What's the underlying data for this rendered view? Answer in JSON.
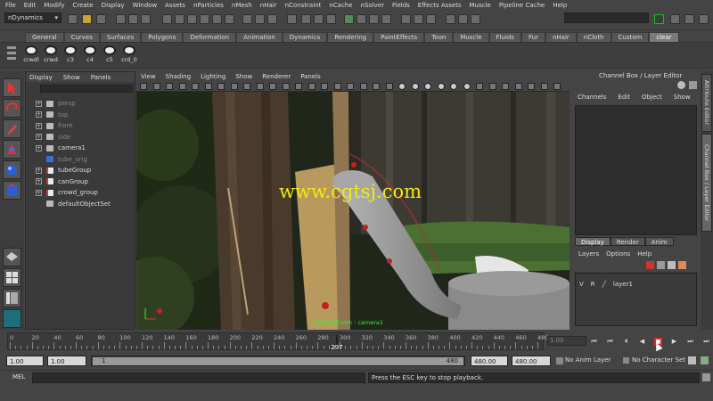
{
  "menubar": [
    "File",
    "Edit",
    "Modify",
    "Create",
    "Display",
    "Window",
    "Assets",
    "nParticles",
    "nMesh",
    "nHair",
    "nConstraint",
    "nCache",
    "nSolver",
    "Fields",
    "Effects Assets",
    "Muscle",
    "Pipeline Cache",
    "Help"
  ],
  "statusline": {
    "mode": "nDynamics"
  },
  "shelf_tabs": [
    "General",
    "Curves",
    "Surfaces",
    "Polygons",
    "Deformation",
    "Animation",
    "Dynamics",
    "Rendering",
    "PaintEffects",
    "Toon",
    "Muscle",
    "Fluids",
    "Fur",
    "nHair",
    "nCloth",
    "Custom",
    "clear"
  ],
  "shelf_active_tab": "clear",
  "shelf_items": [
    "crwdl",
    "crwd",
    "c3",
    "c4",
    "c5",
    "crd_0"
  ],
  "outliner": {
    "menu": [
      "Display",
      "Show",
      "Panels"
    ],
    "items": [
      {
        "label": "persp",
        "expandable": true,
        "dim": true
      },
      {
        "label": "top",
        "expandable": true,
        "dim": true
      },
      {
        "label": "front",
        "expandable": true,
        "dim": true
      },
      {
        "label": "side",
        "expandable": true,
        "dim": true
      },
      {
        "label": "camera1",
        "expandable": true,
        "dim": false
      },
      {
        "label": "tube_orig",
        "expandable": false,
        "dim": true
      },
      {
        "label": "tubeGroup",
        "expandable": true,
        "dim": false
      },
      {
        "label": "canGroup",
        "expandable": true,
        "dim": false
      },
      {
        "label": "crowd_group",
        "expandable": true,
        "dim": false
      },
      {
        "label": "defaultObjectSet",
        "expandable": false,
        "dim": false
      }
    ]
  },
  "viewport": {
    "menu": [
      "View",
      "Shading",
      "Lighting",
      "Show",
      "Renderer",
      "Panels"
    ],
    "watermark": "www.cgtsj.com",
    "camera_label": "20 Pan/Zoom : camera1"
  },
  "channel_box": {
    "title": "Channel Box / Layer Editor",
    "menu": [
      "Channels",
      "Edit",
      "Object",
      "Show"
    ]
  },
  "side_tabs": [
    "Attribute Editor",
    "Channel Box / Layer Editor"
  ],
  "layer_editor": {
    "tabs": [
      "Display",
      "Render",
      "Anim"
    ],
    "active_tab": "Display",
    "menu": [
      "Layers",
      "Options",
      "Help"
    ],
    "layer": {
      "v": "V",
      "r": "R",
      "name": "layer1"
    }
  },
  "timeslider": {
    "ticks": [
      "0",
      "20",
      "40",
      "60",
      "80",
      "100",
      "120",
      "140",
      "160",
      "180",
      "200",
      "220",
      "240",
      "260",
      "280",
      "300",
      "320",
      "340",
      "360",
      "380",
      "400",
      "420",
      "440",
      "460",
      "480"
    ],
    "current_frame": "297",
    "frame_field": "1.00",
    "playback_icons": [
      "go-start",
      "step-back-key",
      "step-back",
      "play-back",
      "stop",
      "play-forward",
      "step-forward-key",
      "go-end"
    ]
  },
  "rangeslider": {
    "start": "1.00",
    "range_start": "1.00",
    "handle_start": "1",
    "handle_end": "480",
    "range_end": "480.00",
    "end": "480.00",
    "anim_layer": "No Anim Layer",
    "character_set": "No Character Set"
  },
  "commandline": {
    "label": "MEL",
    "help": "Press the ESC key to stop playback."
  },
  "colors": {
    "accent_green": "#1fbf1f",
    "playback_stop": "#e02a2a",
    "watermark": "#f2ea10"
  }
}
